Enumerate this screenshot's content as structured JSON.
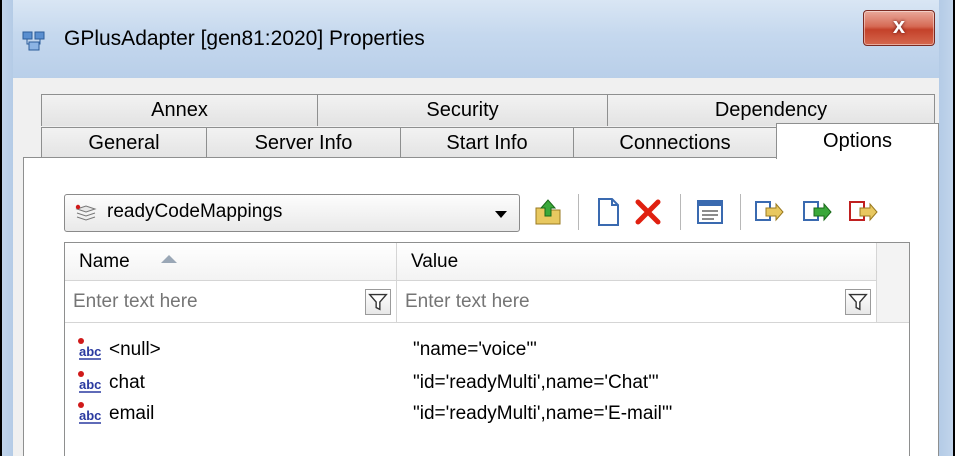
{
  "window": {
    "title": "GPlusAdapter [gen81:2020] Properties",
    "close_label": "x"
  },
  "tabs": {
    "row1": [
      {
        "label": "Annex"
      },
      {
        "label": "Security"
      },
      {
        "label": "Dependency"
      }
    ],
    "row2": [
      {
        "label": "General"
      },
      {
        "label": "Server Info"
      },
      {
        "label": "Start Info"
      },
      {
        "label": "Connections"
      },
      {
        "label": "Options",
        "active": true
      }
    ]
  },
  "section_select": {
    "value": "readyCodeMappings"
  },
  "toolbar": {
    "icons": [
      "folder-up-icon",
      "new-document-icon",
      "delete-icon",
      "properties-icon",
      "copy-icon",
      "import-icon",
      "export-icon"
    ]
  },
  "grid": {
    "columns": [
      {
        "label": "Name",
        "sorted": "ascending"
      },
      {
        "label": "Value"
      }
    ],
    "filters": [
      {
        "placeholder": "Enter text here"
      },
      {
        "placeholder": "Enter text here"
      }
    ],
    "rows": [
      {
        "name": "<null>",
        "value": "\"name='voice'\""
      },
      {
        "name": "chat",
        "value": "\"id='readyMulti',name='Chat'\""
      },
      {
        "name": "email",
        "value": "\"id='readyMulti',name='E-mail'\""
      }
    ]
  },
  "colors": {
    "title_bar": "#c5d8ee",
    "close_button": "#c4412a",
    "delete_icon": "#e02010"
  }
}
